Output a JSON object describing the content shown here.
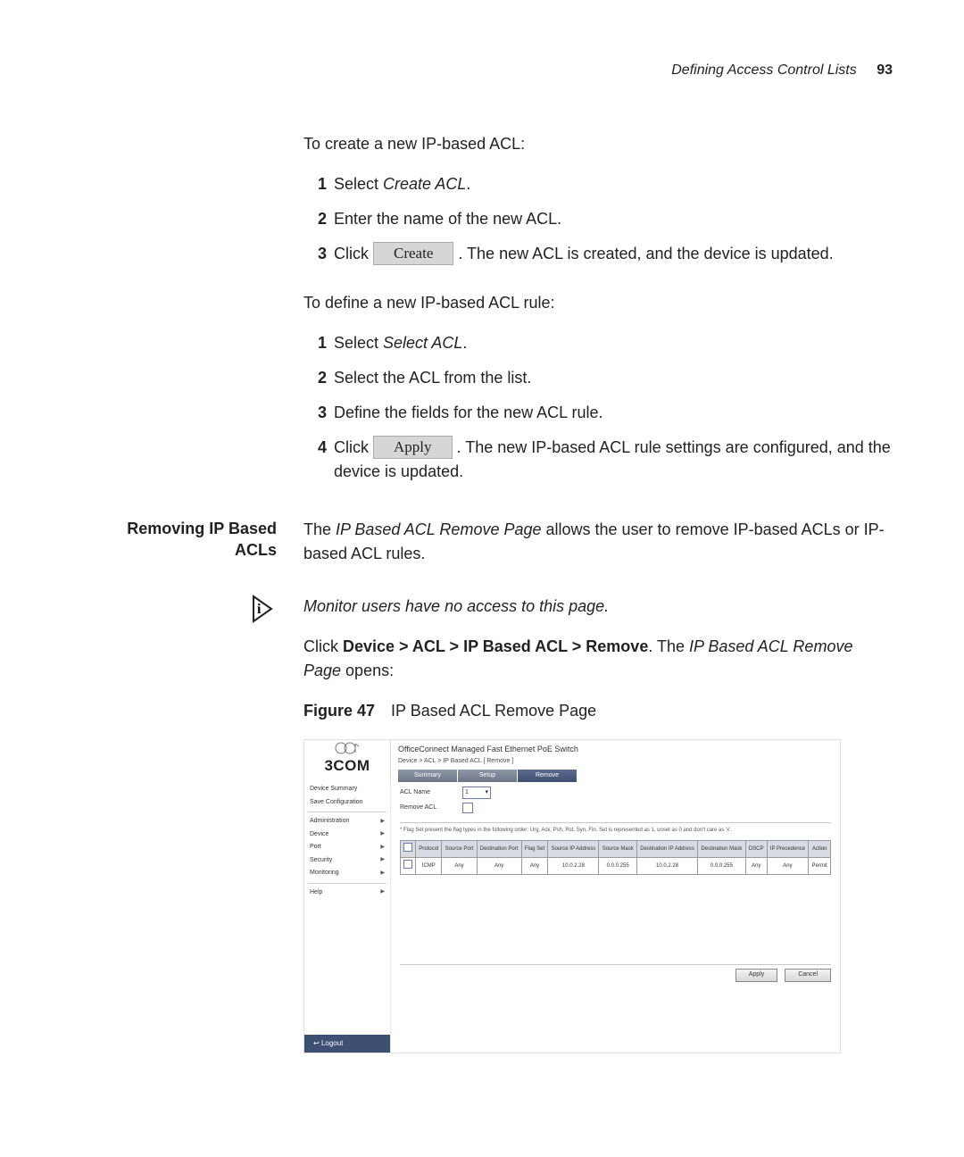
{
  "header": {
    "title": "Defining Access Control Lists",
    "page_number": "93"
  },
  "intro1": "To create a new IP-based ACL:",
  "steps_create": [
    {
      "n": "1",
      "pre": "Select ",
      "ital": "Create ACL",
      "post": "."
    },
    {
      "n": "2",
      "pre": "Enter the name of the new ACL.",
      "ital": "",
      "post": ""
    },
    {
      "n": "3",
      "pre": "Click ",
      "btn": "Create",
      "post_btn": " . The new ACL is created, and the device is updated."
    }
  ],
  "intro2": "To define a new IP-based ACL rule:",
  "steps_rule": [
    {
      "n": "1",
      "pre": "Select ",
      "ital": "Select ACL",
      "post": "."
    },
    {
      "n": "2",
      "pre": "Select the ACL from the list.",
      "ital": "",
      "post": ""
    },
    {
      "n": "3",
      "pre": "Define the fields for the new ACL rule.",
      "ital": "",
      "post": ""
    },
    {
      "n": "4",
      "pre": "Click ",
      "btn": "Apply",
      "post_btn": " . The new IP-based ACL rule settings are configured, and the device is updated."
    }
  ],
  "section_heading_1": "Removing IP Based",
  "section_heading_2": "ACLs",
  "sec_para_pre": "The ",
  "sec_para_ital": "IP Based ACL Remove Page",
  "sec_para_post": " allows the user to remove IP-based ACLs or IP-based ACL rules.",
  "monitor_note": "Monitor users have no access to this page.",
  "click_pre": "Click ",
  "click_path": "Device > ACL > IP Based ACL > Remove",
  "click_mid": ". The ",
  "click_ital": "IP Based ACL Remove Page",
  "click_post": " opens:",
  "figure": {
    "label": "Figure 47",
    "caption": "IP Based ACL Remove Page"
  },
  "shot": {
    "brand": "3COM",
    "title": "OfficeConnect Managed Fast Ethernet PoE Switch",
    "crumb": "Device > ACL > IP Based ACL [ Remove ]",
    "tabs": [
      "Summary",
      "Setup",
      "Remove"
    ],
    "side": {
      "items": [
        "Device Summary",
        "Save Configuration"
      ],
      "caret_items": [
        "Administration",
        "Device",
        "Port",
        "Security",
        "Monitoring"
      ],
      "help": "Help",
      "logout": "Logout"
    },
    "form": {
      "acl_name_label": "ACL Name",
      "acl_name_value": "1",
      "remove_acl_label": "Remove ACL"
    },
    "flag_note": "* Flag Set present the flag types in the following order: Urg, Ack, Psh, Rst, Syn, Fin. Set is represented as 1, unset as 0 and don't care as 'x'.",
    "cols": [
      "",
      "Protocol",
      "Source Port",
      "Destination Port",
      "Flag Set",
      "Source IP Address",
      "Source Mask",
      "Destination IP Address",
      "Destination Mask",
      "DSCP",
      "IP Precedence",
      "Action"
    ],
    "row": [
      "",
      "ICMP",
      "Any",
      "Any",
      "Any",
      "10.0.2.28",
      "0.0.0.255",
      "10.0.2.28",
      "0.0.0.255",
      "Any",
      "Any",
      "Permit"
    ],
    "buttons": {
      "apply": "Apply",
      "cancel": "Cancel"
    }
  }
}
